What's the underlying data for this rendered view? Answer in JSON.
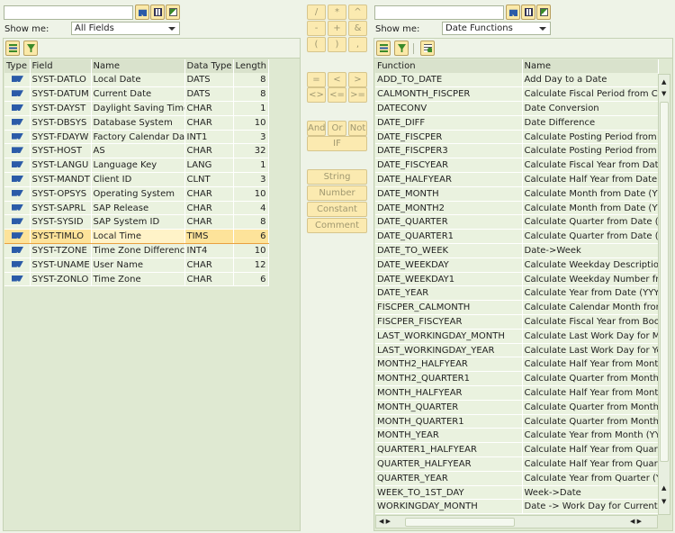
{
  "left": {
    "search_value": "",
    "show_me_label": "Show me:",
    "show_me_value": "All Fields",
    "columns": [
      "Type",
      "Field",
      "Name",
      "Data Type",
      "Length"
    ],
    "rows": [
      [
        "SYST-DATLO",
        "Local Date",
        "DATS",
        "8"
      ],
      [
        "SYST-DATUM",
        "Current Date",
        "DATS",
        "8"
      ],
      [
        "SYST-DAYST",
        "Daylight Saving Time",
        "CHAR",
        "1"
      ],
      [
        "SYST-DBSYS",
        "Database System",
        "CHAR",
        "10"
      ],
      [
        "SYST-FDAYW",
        "Factory Calendar Day",
        "INT1",
        "3"
      ],
      [
        "SYST-HOST",
        "AS",
        "CHAR",
        "32"
      ],
      [
        "SYST-LANGU",
        "Language Key",
        "LANG",
        "1"
      ],
      [
        "SYST-MANDT",
        "Client ID",
        "CLNT",
        "3"
      ],
      [
        "SYST-OPSYS",
        "Operating System",
        "CHAR",
        "10"
      ],
      [
        "SYST-SAPRL",
        "SAP Release",
        "CHAR",
        "4"
      ],
      [
        "SYST-SYSID",
        "SAP System ID",
        "CHAR",
        "8"
      ],
      [
        "SYST-TIMLO",
        "Local Time",
        "TIMS",
        "6"
      ],
      [
        "SYST-TZONE",
        "Time Zone Difference",
        "INT4",
        "10"
      ],
      [
        "SYST-UNAME",
        "User Name",
        "CHAR",
        "12"
      ],
      [
        "SYST-ZONLO",
        "Time Zone",
        "CHAR",
        "6"
      ]
    ],
    "selected_row": "SYST-TIMLO"
  },
  "operators": {
    "row1": [
      "/",
      "*",
      "^"
    ],
    "row2": [
      "-",
      "+",
      "&"
    ],
    "row3": [
      "(",
      ")",
      ","
    ],
    "compare1": [
      "=",
      "<",
      ">"
    ],
    "compare2": [
      "<>",
      "<=",
      ">="
    ],
    "logic": [
      "And",
      "Or",
      "Not"
    ],
    "if": "IF",
    "types": [
      "String",
      "Number",
      "Constant",
      "Comment"
    ]
  },
  "right": {
    "search_value": "",
    "show_me_label": "Show me:",
    "show_me_value": "Date Functions",
    "columns": [
      "Function",
      "Name"
    ],
    "rows": [
      [
        "ADD_TO_DATE",
        "Add Day to a Date"
      ],
      [
        "CALMONTH_FISCPER",
        "Calculate Fiscal Period from Caler"
      ],
      [
        "DATECONV",
        "Date Conversion"
      ],
      [
        "DATE_DIFF",
        "Date Difference"
      ],
      [
        "DATE_FISCPER",
        "Calculate Posting Period from Da"
      ],
      [
        "DATE_FISCPER3",
        "Calculate Posting Period from Da"
      ],
      [
        "DATE_FISCYEAR",
        "Calculate Fiscal Year from Date"
      ],
      [
        "DATE_HALFYEAR",
        "Calculate Half Year from Date (Y"
      ],
      [
        "DATE_MONTH",
        "Calculate Month from Date (YYY"
      ],
      [
        "DATE_MONTH2",
        "Calculate Month from Date (YYY"
      ],
      [
        "DATE_QUARTER",
        "Calculate Quarter from Date (YY"
      ],
      [
        "DATE_QUARTER1",
        "Calculate Quarter from Date (YY"
      ],
      [
        "DATE_TO_WEEK",
        "Date->Week"
      ],
      [
        "DATE_WEEKDAY",
        "Calculate Weekday Description f"
      ],
      [
        "DATE_WEEKDAY1",
        "Calculate Weekday Number from"
      ],
      [
        "DATE_YEAR",
        "Calculate Year from Date (YYYY"
      ],
      [
        "FISCPER_CALMONTH",
        "Calculate Calendar Month from F"
      ],
      [
        "FISCPER_FISCYEAR",
        "Calculate Fiscal Year from Bookin"
      ],
      [
        "LAST_WORKINGDAY_MONTH",
        "Calculate Last Work Day for Mon"
      ],
      [
        "LAST_WORKINGDAY_YEAR",
        "Calculate Last Work Day for Yea"
      ],
      [
        "MONTH2_HALFYEAR",
        "Calculate Half Year from Month ("
      ],
      [
        "MONTH2_QUARTER1",
        "Calculate Quarter from Month (M"
      ],
      [
        "MONTH_HALFYEAR",
        "Calculate Half Year from Month ("
      ],
      [
        "MONTH_QUARTER",
        "Calculate Quarter from Month (Y"
      ],
      [
        "MONTH_QUARTER1",
        "Calculate Quarter from Month (Y"
      ],
      [
        "MONTH_YEAR",
        "Calculate Year from Month (YYY"
      ],
      [
        "QUARTER1_HALFYEAR",
        "Calculate Half Year from Quarter"
      ],
      [
        "QUARTER_HALFYEAR",
        "Calculate Half Year from Quarter"
      ],
      [
        "QUARTER_YEAR",
        "Calculate Year from Quarter (YY"
      ],
      [
        "WEEK_TO_1ST_DAY",
        "Week->Date"
      ],
      [
        "WORKINGDAY_MONTH",
        "Date -> Work Day for Current M"
      ]
    ]
  },
  "colors": {
    "background": "#eef3e7",
    "selected_row": "#fde39a",
    "button": "#fbeab0",
    "type_icon": "#2b5ba8"
  }
}
